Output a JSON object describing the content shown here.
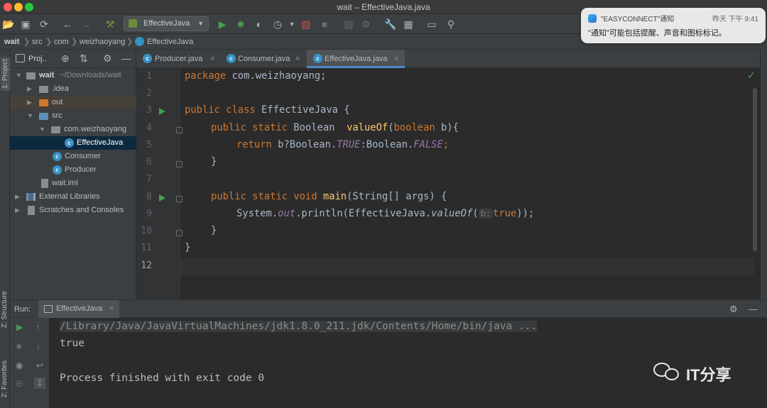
{
  "window": {
    "title": "wait – EffectiveJava.java"
  },
  "toolbar": {
    "run_config": "EffectiveJava",
    "icons": [
      "folder-open-icon",
      "save-icon",
      "sync-icon",
      "back-icon",
      "forward-icon",
      "build-hammer-icon",
      "run-icon",
      "debug-icon",
      "coverage-icon",
      "profile-icon",
      "attach-icon",
      "stop-icon",
      "git-icon",
      "settings-wrench-icon",
      "project-structure-icon",
      "terminal-icon",
      "search-icon"
    ]
  },
  "breadcrumb": {
    "items": [
      "wait",
      "src",
      "com",
      "weizhaoyang",
      "EffectiveJava"
    ]
  },
  "notification": {
    "app": "\"EASYCONNECT\"通知",
    "time": "昨天 下午 9:41",
    "body": "\"通知\"可能包括提醒、声音和图标标记。"
  },
  "side_tabs": {
    "project": "1: Project",
    "structure": "Z: Structure",
    "favorites": "2: Favorites"
  },
  "project_panel": {
    "header": "Proj..",
    "tree": [
      {
        "label": "wait",
        "sub": "~/Downloads/wait"
      },
      {
        "label": ".idea"
      },
      {
        "label": "out"
      },
      {
        "label": "src"
      },
      {
        "label": "com.weizhaoyang"
      },
      {
        "label": "EffectiveJava"
      },
      {
        "label": "Consumer"
      },
      {
        "label": "Producer"
      },
      {
        "label": "wait.iml"
      },
      {
        "label": "External Libraries"
      },
      {
        "label": "Scratches and Consoles"
      }
    ]
  },
  "tabs": [
    {
      "label": "Producer.java"
    },
    {
      "label": "Consumer.java"
    },
    {
      "label": "EffectiveJava.java",
      "active": true
    }
  ],
  "editor": {
    "line_numbers": [
      "1",
      "2",
      "3",
      "4",
      "5",
      "6",
      "7",
      "8",
      "9",
      "10",
      "11",
      "12"
    ],
    "current_line": 12,
    "code": {
      "l1_kw": "package",
      "l1_rest": " com.weizhaoyang;",
      "l3_kw": "public class",
      "l3_rest": " EffectiveJava {",
      "l4_kw": "public static",
      "l4_type": " Boolean  ",
      "l4_fn": "valueOf",
      "l4_paren": "(",
      "l4_kw2": "boolean",
      "l4_rest": " b){",
      "l5_kw": "return",
      "l5_a": " b?Boolean.",
      "l5_true": "TRUE",
      "l5_b": ":Boolean.",
      "l5_false": "FALSE",
      "l5_semi": ";",
      "l6": "}",
      "l8_kw": "public static void",
      "l8_fn": " main",
      "l8_rest": "(String[] args) {",
      "l9_a": "System.",
      "l9_out": "out",
      "l9_b": ".println(EffectiveJava.",
      "l9_call": "valueOf",
      "l9_c": "(",
      "l9_hint": "b:",
      "l9_true": "true",
      "l9_d": "));",
      "l10": "}",
      "l11": "}"
    }
  },
  "run_panel": {
    "label": "Run:",
    "tab": "EffectiveJava",
    "lines": [
      "/Library/Java/JavaVirtualMachines/jdk1.8.0_211.jdk/Contents/Home/bin/java ...",
      "true",
      "",
      "Process finished with exit code 0"
    ]
  },
  "watermark": {
    "text": "IT分享"
  }
}
